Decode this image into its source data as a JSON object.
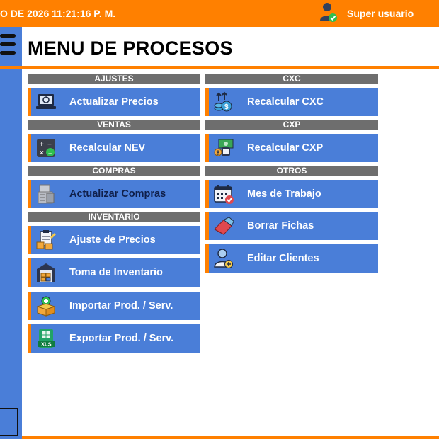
{
  "topbar": {
    "datetime": "O DE 2026 11:21:16 P. M.",
    "user_name": "Super usuario",
    "user_icon": "user-check-icon"
  },
  "sidebar": {
    "menu_icon": "hamburger-menu-icon"
  },
  "page": {
    "title": "MENU DE PROCESOS"
  },
  "sections": {
    "ajustes": {
      "header": "AJUSTES",
      "items": [
        {
          "label": "Actualizar Precios",
          "icon": "laptop-refresh-icon"
        }
      ]
    },
    "ventas": {
      "header": "VENTAS",
      "items": [
        {
          "label": "Recalcular NEV",
          "icon": "calculator-icon"
        }
      ]
    },
    "compras": {
      "header": "COMPRAS",
      "items": [
        {
          "label": "Actualizar Compras",
          "icon": "cash-register-icon"
        }
      ]
    },
    "inventario": {
      "header": "INVENTARIO",
      "items": [
        {
          "label": "Ajuste de Precios",
          "icon": "clipboard-boxes-icon"
        },
        {
          "label": "Toma de Inventario",
          "icon": "warehouse-icon"
        },
        {
          "label": "Importar Prod. / Serv.",
          "icon": "box-import-icon"
        },
        {
          "label": "Exportar Prod. / Serv.",
          "icon": "xls-file-icon"
        }
      ]
    },
    "cxc": {
      "header": "CXC",
      "items": [
        {
          "label": "Recalcular CXC",
          "icon": "coins-arrows-icon"
        }
      ]
    },
    "cxp": {
      "header": "CXP",
      "items": [
        {
          "label": "Recalcular CXP",
          "icon": "money-payment-icon"
        }
      ]
    },
    "otros": {
      "header": "OTROS",
      "items": [
        {
          "label": "Mes de Trabajo",
          "icon": "calendar-check-icon"
        },
        {
          "label": "Borrar Fichas",
          "icon": "eraser-icon"
        },
        {
          "label": "Editar Clientes",
          "icon": "user-add-icon"
        }
      ]
    }
  },
  "colors": {
    "accent_orange": "#ff8000",
    "button_blue": "#4a7ed8",
    "header_gray": "#6e6e6e"
  }
}
